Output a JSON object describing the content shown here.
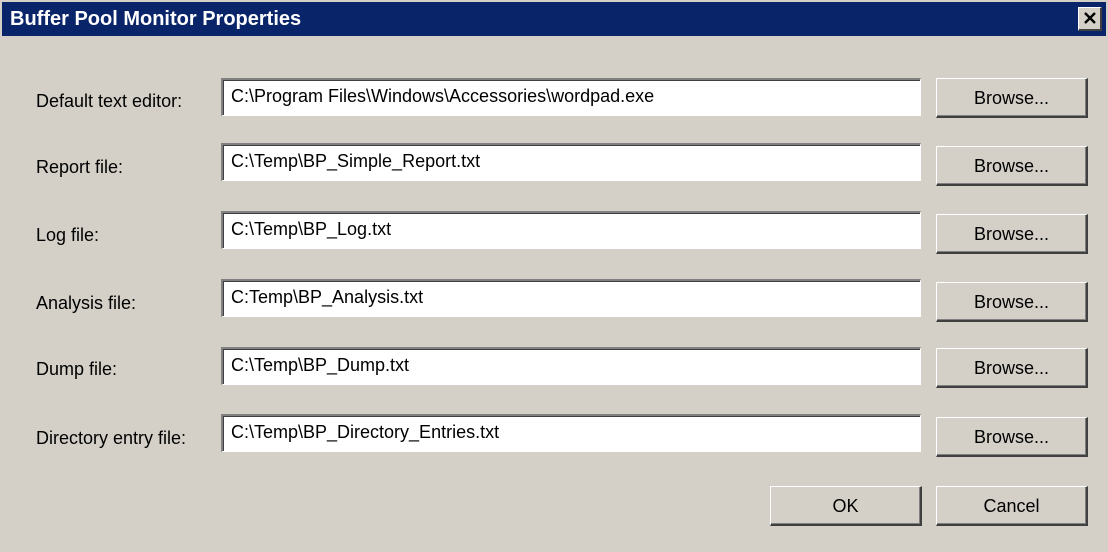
{
  "window": {
    "title": "Buffer Pool Monitor Properties",
    "close_icon": "close-icon"
  },
  "fields": [
    {
      "label": "Default text editor:",
      "value": "C:\\Program Files\\Windows\\Accessories\\wordpad.exe",
      "button": "Browse..."
    },
    {
      "label": "Report file:",
      "value": "C:\\Temp\\BP_Simple_Report.txt",
      "button": "Browse..."
    },
    {
      "label": "Log file:",
      "value": "C:\\Temp\\BP_Log.txt",
      "button": "Browse..."
    },
    {
      "label": "Analysis file:",
      "value": "C:Temp\\BP_Analysis.txt",
      "button": "Browse..."
    },
    {
      "label": "Dump file:",
      "value": "C:\\Temp\\BP_Dump.txt",
      "button": "Browse..."
    },
    {
      "label": "Directory entry file:",
      "value": "C:\\Temp\\BP_Directory_Entries.txt",
      "button": "Browse..."
    }
  ],
  "buttons": {
    "ok": "OK",
    "cancel": "Cancel"
  },
  "colors": {
    "titlebar": "#0a246a",
    "face": "#d4d0c8"
  }
}
